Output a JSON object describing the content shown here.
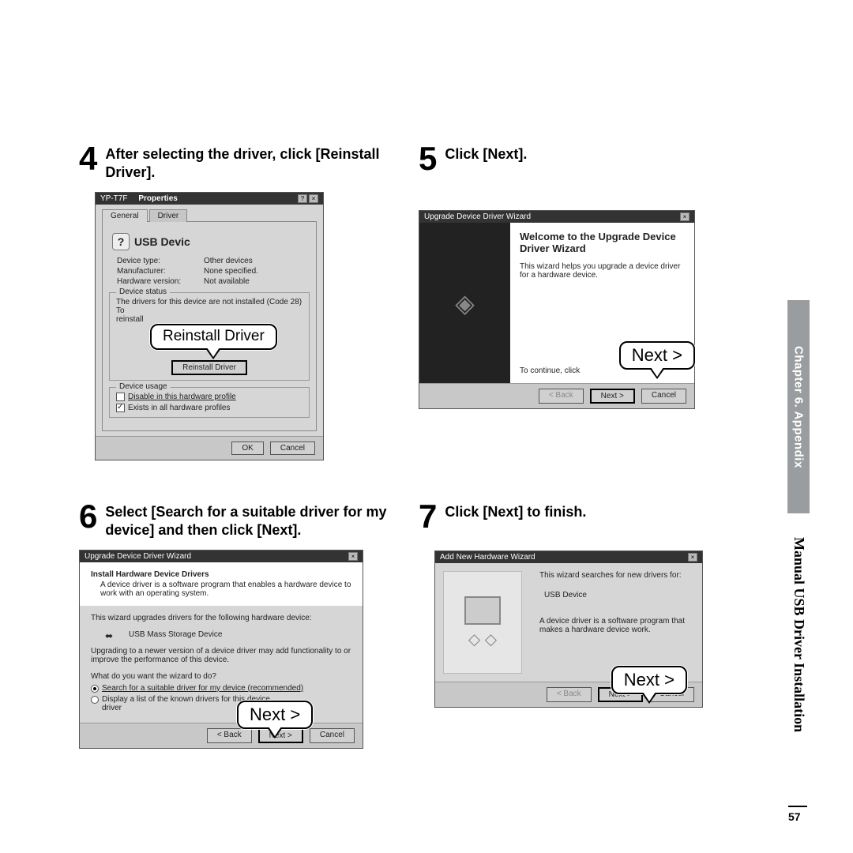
{
  "sidebar": {
    "chapter": "Chapter 6. Appendix",
    "section": "Manual USB Driver Installation",
    "page": "57"
  },
  "steps": {
    "s4": {
      "num": "4",
      "text": "After selecting the driver, click [Reinstall Driver]."
    },
    "s5": {
      "num": "5",
      "text": "Click [Next]."
    },
    "s6": {
      "num": "6",
      "text": "Select  [Search for a suitable driver for my device] and then click [Next]."
    },
    "s7": {
      "num": "7",
      "text": "Click [Next] to finish."
    }
  },
  "callouts": {
    "reinstall": "Reinstall Driver",
    "next5": "Next >",
    "next6": "Next >",
    "next7": "Next >"
  },
  "dlg4": {
    "title_left": "YP-T7F",
    "title_right": "Properties",
    "tabs": {
      "general": "General",
      "driver": "Driver"
    },
    "device_name": "USB Devic",
    "kv": {
      "type_k": "Device type:",
      "type_v": "Other devices",
      "mfr_k": "Manufacturer:",
      "mfr_v": "None specified.",
      "hw_k": "Hardware version:",
      "hw_v": "Not available"
    },
    "status_legend": "Device status",
    "status_line1": "The drivers for this device are not installed (Code 28) To",
    "status_line2": "reinstall",
    "reinstall_btn": "Reinstall Driver",
    "usage_legend": "Device usage",
    "chk1": "Disable in this hardware profile",
    "chk2": "Exists in all hardware profiles",
    "ok": "OK",
    "cancel": "Cancel"
  },
  "dlg5": {
    "title": "Upgrade Device Driver Wizard",
    "heading": "Welcome to the Upgrade Device Driver Wizard",
    "body": "This wizard helps you upgrade a device driver for a hardware device.",
    "continue": "To continue, click",
    "back": "< Back",
    "next": "Next >",
    "cancel": "Cancel"
  },
  "dlg6": {
    "title": "Upgrade Device Driver Wizard",
    "heading": "Install Hardware Device Drivers",
    "sub": "A device driver is a software program that enables a hardware device to work with an operating system.",
    "line": "This wizard upgrades drivers for the following hardware device:",
    "device": "USB Mass Storage Device",
    "upgrade_note": "Upgrading to a newer version of a device driver may add functionality to or improve the performance of this device.",
    "question": "What do you want the wizard to do?",
    "opt1": "Search for a suitable driver for my device (recommended)",
    "opt2": "Display a list of the known drivers for this device",
    "opt2b": "driver",
    "back": "< Back",
    "next": "Next >",
    "cancel": "Cancel"
  },
  "dlg7": {
    "title": "Add New Hardware Wizard",
    "line1": "This wizard searches for new drivers for:",
    "device": "USB Device",
    "line2": "A device driver is a software program that makes a hardware device work.",
    "back": "< Back",
    "next": "Next >",
    "cancel": "Cancel"
  }
}
